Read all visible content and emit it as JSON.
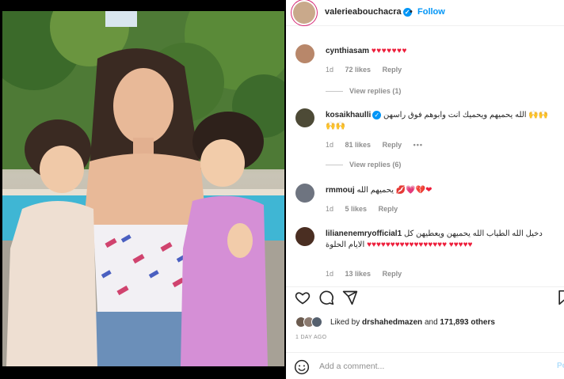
{
  "post": {
    "username": "valerieabouchacra",
    "verified_mark": "✓",
    "separator": "•",
    "follow_label": "Follow"
  },
  "comments": [
    {
      "username": "cynthiasam",
      "text": "",
      "hearts": "♥♥♥♥♥♥♥",
      "age": "1d",
      "likes": "72 likes",
      "reply": "Reply",
      "view_replies": "View replies (1)"
    },
    {
      "username": "kosaikhaulli",
      "verified_mark": "✓",
      "text": "الله يحميهم ويحميك انت وابوهم فوق راسهن",
      "emoji": "🙌🙌🙌🙌",
      "age": "1d",
      "likes": "81 likes",
      "reply": "Reply",
      "more": "•••",
      "view_replies": "View replies (6)"
    },
    {
      "username": "rmmouj",
      "text": "يحميهم الله",
      "hearts": "💋💗💔❤",
      "age": "1d",
      "likes": "5 likes",
      "reply": "Reply"
    },
    {
      "username": "lilianenemryofficial1",
      "text": "دخيل الله الطياب الله يحميهن ويعطيهن كل الايام الحلوة",
      "hearts": "♥♥♥♥♥♥♥♥♥♥♥♥♥♥♥♥♥",
      "hearts2": "♥♥♥♥♥",
      "age": "1d",
      "likes": "13 likes",
      "reply": "Reply"
    }
  ],
  "actions": {
    "icons": [
      "heart-icon",
      "comment-icon",
      "share-icon",
      "bookmark-icon"
    ]
  },
  "likes": {
    "prefix": "Liked by",
    "user": "drshahedmazen",
    "suffix": "and",
    "others": "171,893 others"
  },
  "timestamp": "1 DAY AGO",
  "add_comment": {
    "placeholder": "Add a comment...",
    "post_label": "Post"
  },
  "colors": {
    "accent": "#0095f6",
    "heart": "#ed1d3a",
    "muted": "#8e8e8e"
  }
}
